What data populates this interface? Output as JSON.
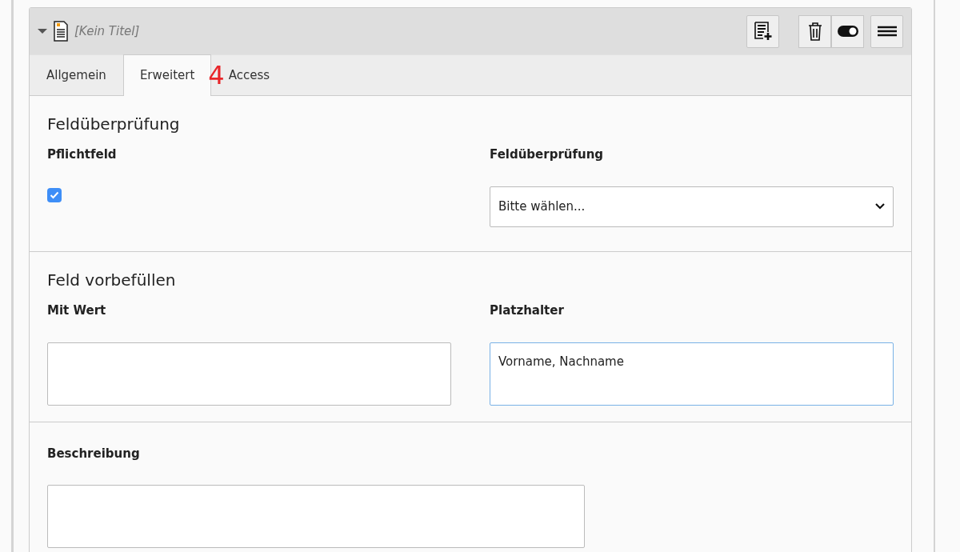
{
  "header": {
    "expanded": true,
    "title": "[Kein Titel]",
    "toggle_on": true
  },
  "tabs": [
    {
      "label": "Allgemein",
      "selected": false
    },
    {
      "label": "Erweitert",
      "selected": true
    },
    {
      "label": "Access",
      "selected": false
    }
  ],
  "annotation_marker": "4",
  "sections": [
    {
      "title": "Feldüberprüfung",
      "fields": [
        {
          "kind": "checkbox",
          "label": "Pflichtfeld",
          "checked": true
        },
        {
          "kind": "select",
          "label": "Feldüberprüfung",
          "value": "Bitte wählen..."
        }
      ]
    },
    {
      "title": "Feld vorbefüllen",
      "fields": [
        {
          "kind": "text",
          "label": "Mit Wert",
          "focused": false
        },
        {
          "kind": "text",
          "label": "Platzhalter",
          "value": "Vorname, Nachname",
          "focused": true
        }
      ]
    },
    {
      "fields": [
        {
          "kind": "text",
          "label": "Beschreibung",
          "focused": false
        }
      ]
    }
  ]
}
